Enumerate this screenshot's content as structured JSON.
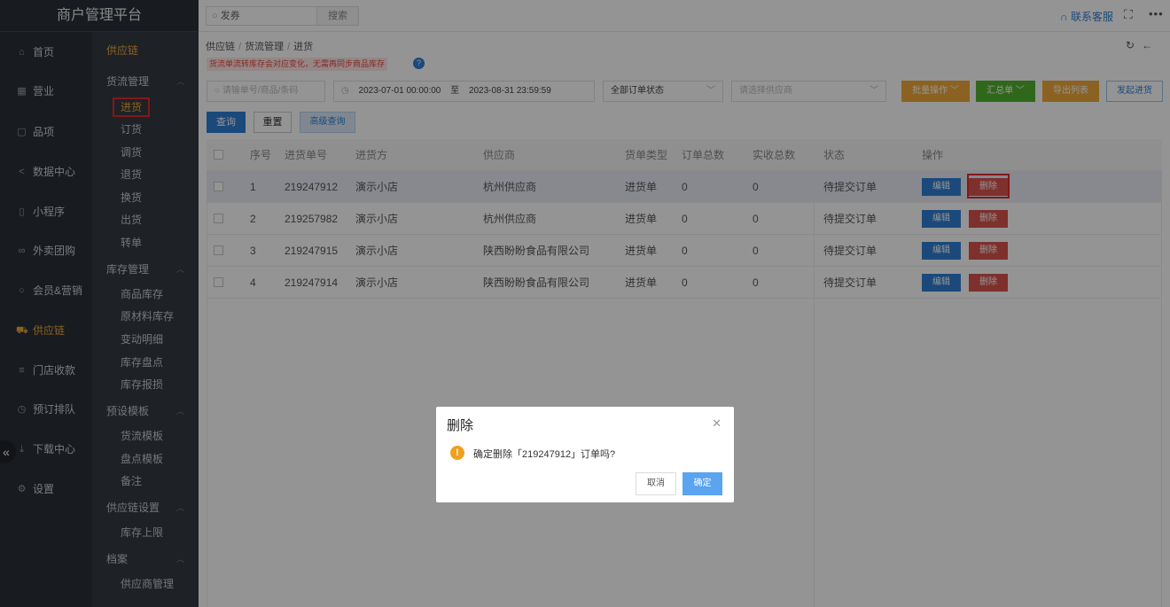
{
  "brand": "商户管理平台",
  "topbar": {
    "search_value": "发券",
    "search_button": "搜索",
    "contact": "联系客服"
  },
  "nav": [
    {
      "label": "首页",
      "icon": "home-icon"
    },
    {
      "label": "营业",
      "icon": "calendar-icon"
    },
    {
      "label": "品项",
      "icon": "bag-icon"
    },
    {
      "label": "数据中心",
      "icon": "share-icon"
    },
    {
      "label": "小程序",
      "icon": "phone-icon"
    },
    {
      "label": "外卖团购",
      "icon": "bike-icon"
    },
    {
      "label": "会员&营销",
      "icon": "user-icon"
    },
    {
      "label": "供应链",
      "icon": "truck-icon"
    },
    {
      "label": "门店收款",
      "icon": "database-icon"
    },
    {
      "label": "预订排队",
      "icon": "clock-icon"
    },
    {
      "label": "下载中心",
      "icon": "download-icon"
    },
    {
      "label": "设置",
      "icon": "gear-icon"
    }
  ],
  "subnav": {
    "top": "供应链",
    "groups": [
      {
        "title": "货流管理",
        "items": [
          "进货",
          "订货",
          "调货",
          "退货",
          "换货",
          "出货",
          "转单"
        ]
      },
      {
        "title": "库存管理",
        "items": [
          "商品库存",
          "原材料库存",
          "变动明细",
          "库存盘点",
          "库存报损"
        ]
      },
      {
        "title": "预设模板",
        "items": [
          "货流模板",
          "盘点模板",
          "备注"
        ]
      },
      {
        "title": "供应链设置",
        "items": [
          "库存上限"
        ]
      },
      {
        "title": "档案",
        "items": [
          "供应商管理"
        ]
      }
    ]
  },
  "breadcrumb": [
    "供应链",
    "货流管理",
    "进货"
  ],
  "notice": "货流单流转库存会对应变化，无需再同步商品库存",
  "filters": {
    "keyword_placeholder": "请输单号/商品/条码",
    "date_start": "2023-07-01 00:00:00",
    "date_sep": "至",
    "date_end": "2023-08-31 23:59:59",
    "status": "全部订单状态",
    "supplier_placeholder": "请选择供应商"
  },
  "actions": {
    "batch": "批量操作",
    "summary": "汇总单",
    "export": "导出列表",
    "create": "发起进货",
    "query": "查询",
    "reset": "重置",
    "advanced": "高级查询"
  },
  "table": {
    "columns": [
      "序号",
      "进货单号",
      "进货方",
      "供应商",
      "货单类型",
      "订单总数",
      "实收总数",
      "状态",
      "操作"
    ],
    "rows": [
      [
        "1",
        "219247912",
        "演示小店",
        "杭州供应商",
        "进货单",
        "0",
        "0",
        "待提交订单"
      ],
      [
        "2",
        "219257982",
        "演示小店",
        "杭州供应商",
        "进货单",
        "0",
        "0",
        "待提交订单"
      ],
      [
        "3",
        "219247915",
        "演示小店",
        "陕西盼盼食品有限公司",
        "进货单",
        "0",
        "0",
        "待提交订单"
      ],
      [
        "4",
        "219247914",
        "演示小店",
        "陕西盼盼食品有限公司",
        "进货单",
        "0",
        "0",
        "待提交订单"
      ]
    ],
    "edit_label": "编辑",
    "delete_label": "删除"
  },
  "dialog": {
    "title": "删除",
    "message": "确定删除「219247912」订单吗?",
    "cancel": "取消",
    "confirm": "确定"
  },
  "colors": {
    "accent": "#f0a93b",
    "primary": "#2f7fd4",
    "danger": "#d9534f",
    "highlight_box": "#e02b2b"
  }
}
